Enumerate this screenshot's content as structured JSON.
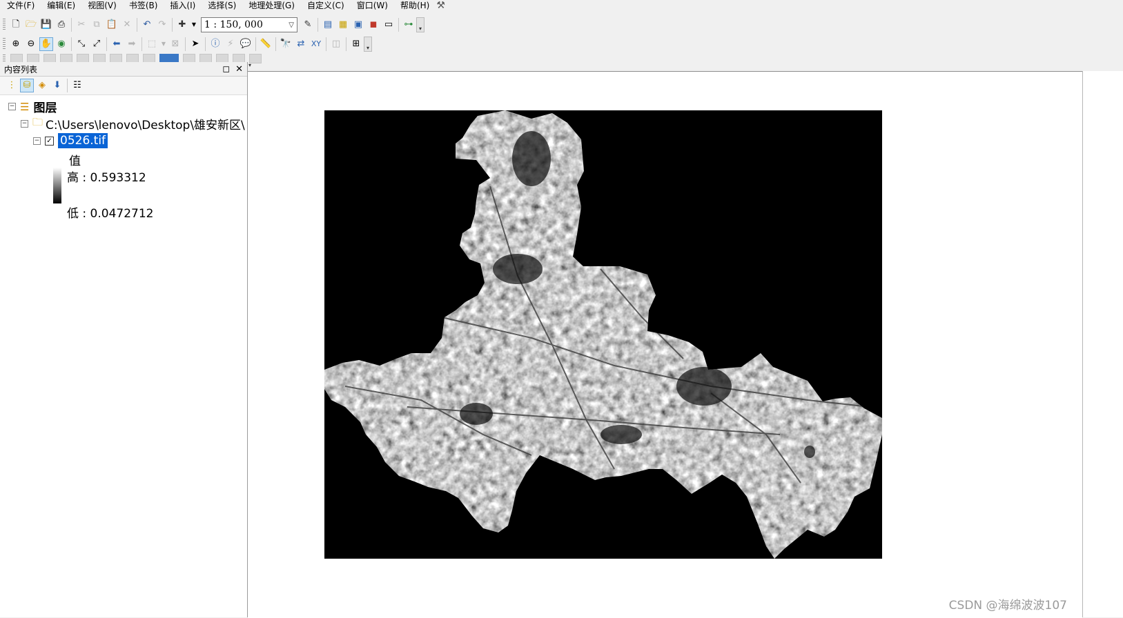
{
  "menu": {
    "items": [
      "文件(F)",
      "编辑(E)",
      "视图(V)",
      "书签(B)",
      "插入(I)",
      "选择(S)",
      "地理处理(G)",
      "自定义(C)",
      "窗口(W)",
      "帮助(H)"
    ],
    "tool_icon": "hammer-icon"
  },
  "toolbar": {
    "scale_value": "1 : 150, 000"
  },
  "toc": {
    "title": "内容列表",
    "layers_root": "图层",
    "path": "C:\\Users\\lenovo\\Desktop\\雄安新区\\",
    "layer_name": "0526.tif",
    "layer_checked": true,
    "legend_heading": "值",
    "legend_high": "高 : 0.593312",
    "legend_low": "低 : 0.0472712"
  },
  "map": {
    "background": "#ffffff",
    "raster_background": "#000000"
  },
  "watermark": "CSDN @海绵波波107",
  "colors": {
    "selection": "#0a64d6",
    "panel_bg": "#f0f0f0"
  }
}
